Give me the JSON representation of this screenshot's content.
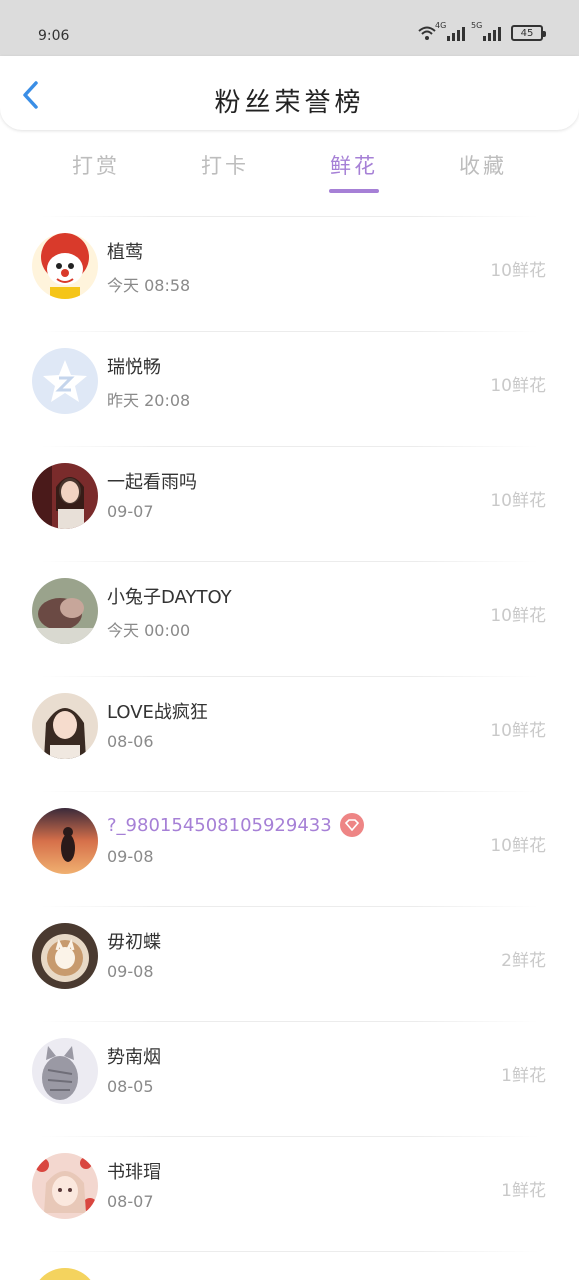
{
  "status_bar": {
    "time": "9:06",
    "network1": "4G",
    "network2": "5G",
    "battery": "45"
  },
  "header": {
    "title": "粉丝荣誉榜"
  },
  "tabs": [
    {
      "label": "打赏",
      "active": false
    },
    {
      "label": "打卡",
      "active": false
    },
    {
      "label": "鲜花",
      "active": true
    },
    {
      "label": "收藏",
      "active": false
    }
  ],
  "colors": {
    "accent": "#a680d6",
    "muted": "#bdbdbd",
    "vip_badge": "#ee8585"
  },
  "list": [
    {
      "name": "植莺",
      "date": "今天 08:58",
      "count": "10鲜花",
      "avatar_icon": "clown-avatar"
    },
    {
      "name": "瑞悦畅",
      "date": "昨天 20:08",
      "count": "10鲜花",
      "avatar_icon": "default-star-avatar"
    },
    {
      "name": "一起看雨吗",
      "date": "09-07",
      "count": "10鲜花",
      "avatar_icon": "girl-photo-avatar"
    },
    {
      "name": "小兔子DAYTOY",
      "date": "今天 00:00",
      "count": "10鲜花",
      "avatar_icon": "photo-avatar"
    },
    {
      "name": "LOVE战疯狂",
      "date": "08-06",
      "count": "10鲜花",
      "avatar_icon": "girl-photo-avatar"
    },
    {
      "name": "?_980154508105929433",
      "date": "09-08",
      "count": "10鲜花",
      "avatar_icon": "sunset-avatar",
      "vip": true
    },
    {
      "name": "毋初蝶",
      "date": "09-08",
      "count": "2鲜花",
      "avatar_icon": "latte-art-avatar"
    },
    {
      "name": "势南烟",
      "date": "08-05",
      "count": "1鲜花",
      "avatar_icon": "cat-avatar"
    },
    {
      "name": "书琲瑁",
      "date": "08-07",
      "count": "1鲜花",
      "avatar_icon": "anime-girl-avatar"
    }
  ]
}
